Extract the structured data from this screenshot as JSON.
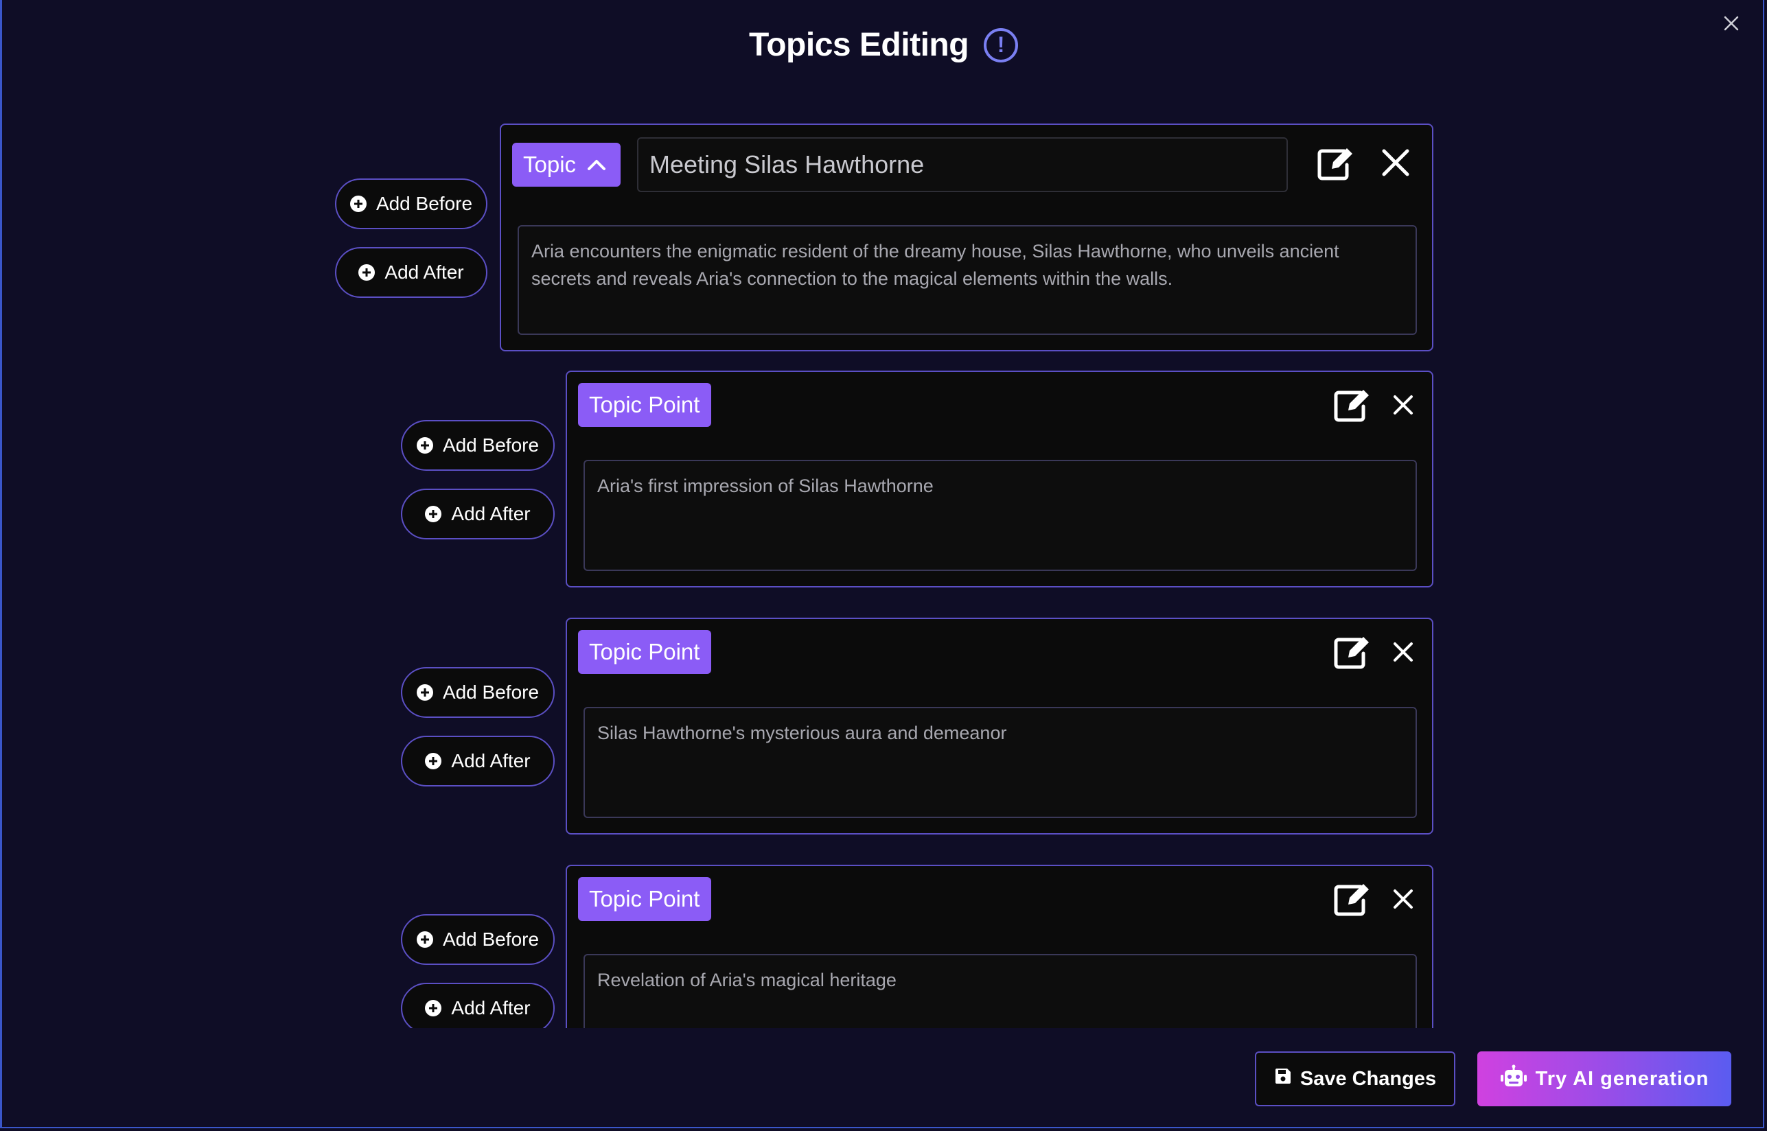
{
  "modal": {
    "title": "Topics Editing"
  },
  "topic": {
    "badge_label": "Topic",
    "title_value": "Meeting Silas Hawthorne",
    "description": "Aria encounters the enigmatic resident of the dreamy house, Silas Hawthorne, who unveils ancient secrets and reveals Aria's connection to the magical elements within the walls."
  },
  "points": [
    {
      "badge_label": "Topic Point",
      "description": "Aria's first impression of Silas Hawthorne"
    },
    {
      "badge_label": "Topic Point",
      "description": "Silas Hawthorne's mysterious aura and demeanor"
    },
    {
      "badge_label": "Topic Point",
      "description": "Revelation of Aria's magical heritage"
    }
  ],
  "actions": {
    "add_before": "Add Before",
    "add_after": "Add After"
  },
  "footer": {
    "save_label": "Save Changes",
    "ai_label": "Try AI generation"
  },
  "colors": {
    "background": "#0f0d26",
    "card_border": "#5b4fc4",
    "badge": "#8b5cf6",
    "info_icon": "#7a7ff2"
  }
}
